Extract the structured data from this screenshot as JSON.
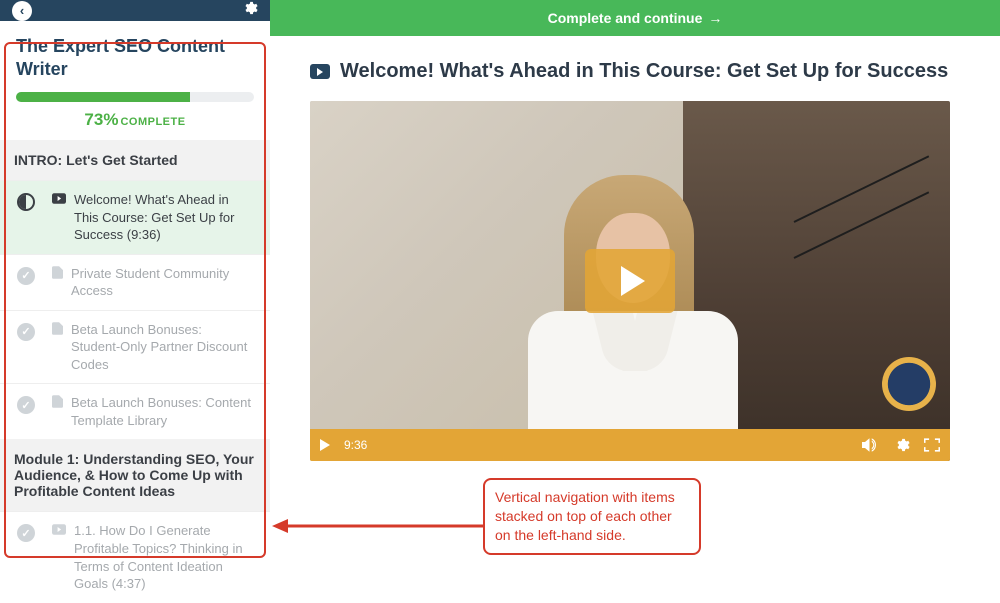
{
  "sidebar": {
    "course_title": "The Expert SEO Content Writer",
    "progress": {
      "percent": "73%",
      "label": "COMPLETE",
      "fill_pct": 73
    },
    "sections": [
      {
        "header": "INTRO: Let's Get Started",
        "items": [
          {
            "status": "half",
            "type": "video",
            "label": "Welcome! What's Ahead in This Course: Get Set Up for Success (9:36)",
            "active": true
          },
          {
            "status": "done",
            "type": "doc",
            "label": "Private Student Community Access"
          },
          {
            "status": "done",
            "type": "doc",
            "label": "Beta Launch Bonuses: Student-Only Partner Discount Codes"
          },
          {
            "status": "done",
            "type": "doc",
            "label": "Beta Launch Bonuses: Content Template Library"
          }
        ]
      },
      {
        "header": "Module 1: Understanding SEO, Your Audience, & How to Come Up with Profitable Content Ideas",
        "items": [
          {
            "status": "done",
            "type": "video",
            "label": "1.1. How Do I Generate Profitable Topics? Thinking in Terms of Content Ideation Goals (4:37)"
          }
        ]
      }
    ]
  },
  "topbar": {
    "label": "Complete and continue",
    "arrow": "→"
  },
  "lesson_title": "Welcome! What's Ahead in This Course: Get Set Up for Success",
  "player": {
    "time": "9:36"
  },
  "annotation": {
    "text": "Vertical navigation with items stacked on top of each other on the left-hand side."
  },
  "colors": {
    "navy": "#26455f",
    "green": "#48b859",
    "orange": "#e3a536",
    "annot_red": "#d53a2a"
  }
}
